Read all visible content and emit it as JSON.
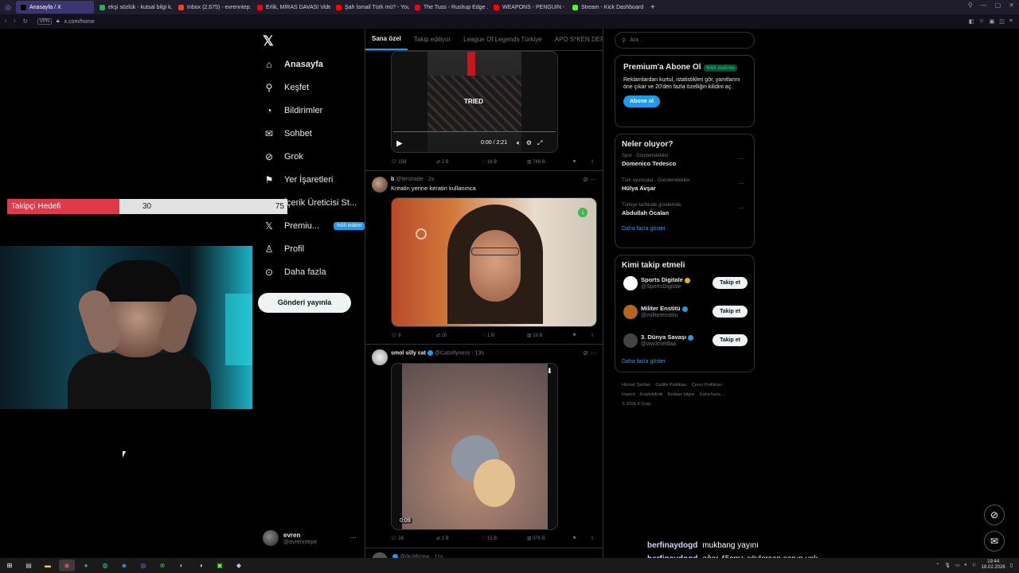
{
  "browser": {
    "tabs": [
      {
        "label": "Anasayfa / X",
        "active": true,
        "color": "#000000"
      },
      {
        "label": "ekşi sözlük - kutsal bilgi k...",
        "active": false,
        "color": "#27ae60"
      },
      {
        "label": "Inbox (2,675) - evrenntep...",
        "active": false,
        "color": "#ea4335"
      },
      {
        "label": "Erlik, MİRAS DAVASI Vide...",
        "active": false,
        "color": "#ff0000"
      },
      {
        "label": "Şah İsmail Türk mü? - You...",
        "active": false,
        "color": "#ff0000"
      },
      {
        "label": "The Tuss - Rushup Edge ...",
        "active": false,
        "color": "#ff0000"
      },
      {
        "label": "WEAPONS - PENGUIN - ...",
        "active": false,
        "color": "#ff0000"
      },
      {
        "label": "Stream - Kick Dashboard",
        "active": false,
        "color": "#53fc18"
      }
    ],
    "new_tab": "+",
    "vpn": "VPN",
    "url": "x.com/home"
  },
  "nav": {
    "items": [
      {
        "label": "Anasayfa",
        "icon": "home-icon",
        "glyph": "⌂",
        "bold": true
      },
      {
        "label": "Keşfet",
        "icon": "search-icon",
        "glyph": "⚲"
      },
      {
        "label": "Bildirimler",
        "icon": "bell-icon",
        "glyph": "◔"
      },
      {
        "label": "Sohbet",
        "icon": "mail-icon",
        "glyph": "✉"
      },
      {
        "label": "Grok",
        "icon": "grok-icon",
        "glyph": "⊘"
      },
      {
        "label": "Yer İşaretleri",
        "icon": "bookmark-icon",
        "glyph": "⚑"
      },
      {
        "label": "İçerik Üreticisi St...",
        "icon": "creator-icon",
        "glyph": "▦"
      },
      {
        "label": "Premiu...",
        "icon": "x-premium-icon",
        "glyph": "𝕏"
      },
      {
        "label": "Profil",
        "icon": "profile-icon",
        "glyph": "♙"
      },
      {
        "label": "Daha fazla",
        "icon": "more-icon",
        "glyph": "⊙"
      }
    ],
    "premium_badge": "%50 indirim",
    "post_button": "Gönderi yayınla",
    "profile_name": "evren",
    "profile_handle": "@evrenntepe"
  },
  "overlay": {
    "goal_label": "Takipçi Hedefi",
    "goal_current": "30",
    "goal_target": "75"
  },
  "feed": {
    "tabs": [
      {
        "label": "Sana özel",
        "active": true
      },
      {
        "label": "Takip ediliyor",
        "active": false
      },
      {
        "label": "League Of Legends Türkiye",
        "active": false
      },
      {
        "label": "APO S*KEN DERNE",
        "active": false
      }
    ],
    "video1": {
      "caption": "TRIED",
      "time": "0:00 / 2:21",
      "replies": "158",
      "reposts": "2 B",
      "likes": "16 B",
      "views": "746 B"
    },
    "tweet2": {
      "name": "b",
      "handle": "@tersirade · 2s",
      "text": "Kreatin yerine keratin kullanınca",
      "replies": "8",
      "reposts": "20",
      "likes": "1 B",
      "views": "18 B"
    },
    "tweet3": {
      "name": "smol silly cat",
      "handle": "@Catsillyness · 13s",
      "duration": "0:09",
      "replies": "38",
      "reposts": "2 B",
      "likes": "15 B",
      "views": "376 B"
    },
    "tweet4": {
      "handle": "@de3dcrew · 11s"
    }
  },
  "right": {
    "search_placeholder": "Ara",
    "premium_title": "Premium'a Abone Ol",
    "premium_discount": "%50 indirim",
    "premium_text": "Reklamlardan kurtul, istatistikleri gör, yanıtlarını öne çıkar ve 20'den fazla özelliğin kilidini aç.",
    "premium_button": "Abone ol",
    "trends_title": "Neler oluyor?",
    "trends": [
      {
        "category": "Spor · Gündemdekiler",
        "name": "Domenico Tedesco"
      },
      {
        "category": "Türk oyuncular · Gündemdekiler",
        "name": "Hülya Avşar"
      },
      {
        "category": "Türkiye tarihinde gündemde",
        "name": "Abdullah Öcalan"
      }
    ],
    "trends_more": "Daha fazla göster",
    "follow_title": "Kimi takip etmeli",
    "follow": [
      {
        "name": "Sports Digitale",
        "handle": "@SportsDigitale",
        "button": "Takip et",
        "color": "#ffffff",
        "gold": true
      },
      {
        "name": "Militer Enstitü",
        "handle": "@militerenstitu",
        "button": "Takip et",
        "color": "#b5651d",
        "gold": false
      },
      {
        "name": "3. Dünya Savaşı",
        "handle": "@ww3medlaa",
        "button": "Takip et",
        "color": "#444444",
        "gold": false
      }
    ],
    "follow_more": "Daha fazla göster",
    "footer_links": [
      "Hizmet Şartları",
      "Gizlilik Politikası",
      "Çerez Politikası",
      "Imprint",
      "Erişilebilirlik",
      "Reklam bilgisi",
      "Daha fazla ...",
      "© 2026 X Corp."
    ]
  },
  "chat": [
    {
      "user": "berfinaydogd",
      "message": "mukbang yayını"
    },
    {
      "user": "berfinaydogd",
      "message": "eğer 45cm+ söylersen sorun yok"
    }
  ],
  "taskbar": {
    "time": "19:44",
    "date": "18.02.2026"
  },
  "colors": {
    "accent": "#1d9bf0",
    "goal_bar": "#e03a48",
    "green_badge": "#00ba7c"
  }
}
